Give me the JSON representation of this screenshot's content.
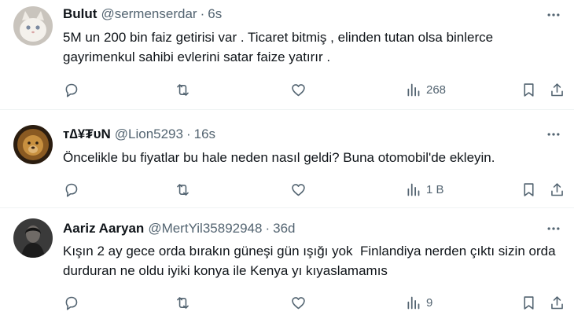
{
  "feed": {
    "tweets": [
      {
        "name": "Bulut",
        "handle": "@sermenserdar",
        "separator": "·",
        "time": "6s",
        "text": "5M un 200 bin faiz getirisi var . Ticaret bitmiş , elinden tutan olsa binlerce gayrimenkul sahibi evlerini satar faize yatırır .",
        "views": "268",
        "avatar_icon": "white-cat-avatar"
      },
      {
        "name": "ᴛ∆¥₮ᴜN",
        "handle": "@Lion5293",
        "separator": "·",
        "time": "16s",
        "text": "Öncelikle bu fiyatlar bu hale neden nasıl geldi? Buna otomobil'de ekleyin.",
        "views": "1 B",
        "avatar_icon": "lion-avatar"
      },
      {
        "name": "Aariz Aaryan",
        "handle": "@MertYil35892948",
        "separator": "·",
        "time": "36d",
        "text": "Kışın 2 ay gece orda bırakın güneşi gün ışığı yok  Finlandiya nerden çıktı sizin orda durduran ne oldu iyiki konya ile Kenya yı kıyaslamamıs",
        "views": "9",
        "avatar_icon": "dark-portrait-avatar"
      }
    ]
  },
  "colors": {
    "text_primary": "#0f1419",
    "text_secondary": "#536471",
    "divider": "#eff3f4"
  },
  "icons": [
    "reply-icon",
    "retweet-icon",
    "like-icon",
    "views-icon",
    "bookmark-icon",
    "share-icon",
    "more-icon"
  ]
}
